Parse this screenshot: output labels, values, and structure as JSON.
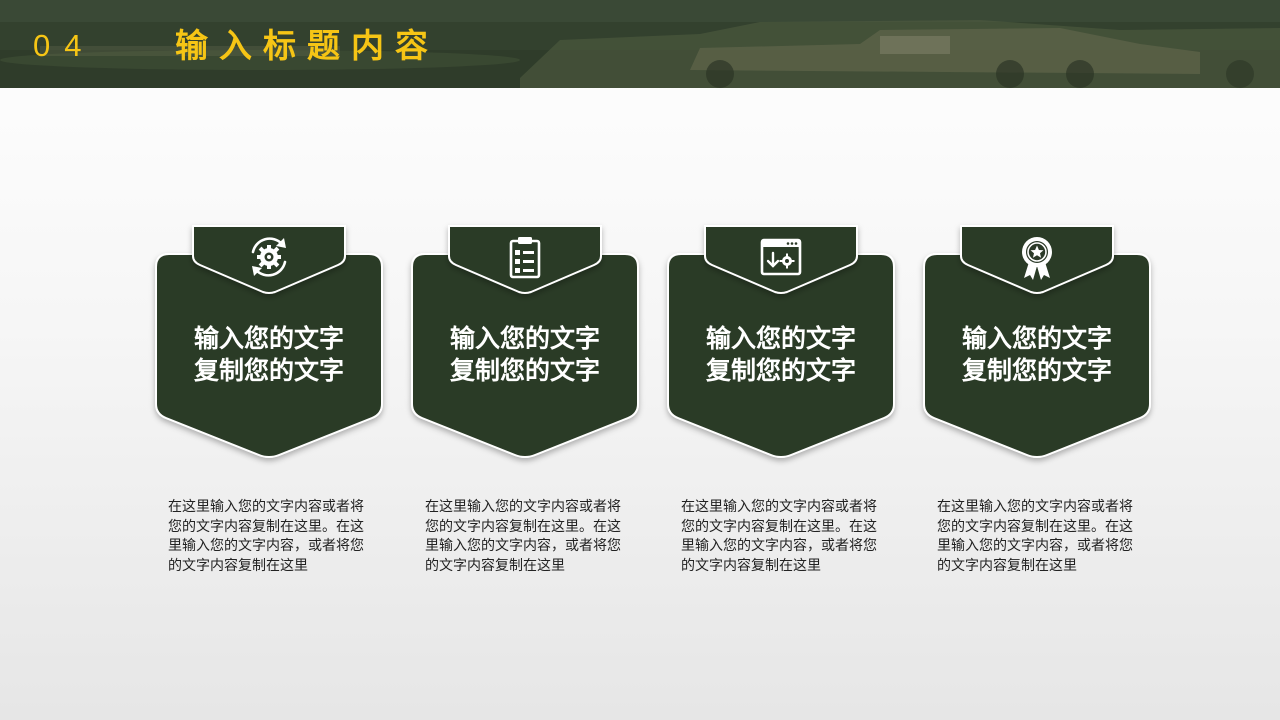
{
  "header": {
    "number": "04",
    "title": "输入标题内容"
  },
  "colors": {
    "card_fill": "#2c3a28",
    "accent_yellow": "#f6c515",
    "header_bg": "#3a4a34"
  },
  "cards": [
    {
      "icon": "gear-cycle-icon",
      "title_line1": "输入您的文字",
      "title_line2": "复制您的文字",
      "description": "在这里输入您的文字内容或者将您的文字内容复制在这里。在这里输入您的文字内容，或者将您的文字内容复制在这里"
    },
    {
      "icon": "clipboard-checklist-icon",
      "title_line1": "输入您的文字",
      "title_line2": "复制您的文字",
      "description": "在这里输入您的文字内容或者将您的文字内容复制在这里。在这里输入您的文字内容，或者将您的文字内容复制在这里"
    },
    {
      "icon": "browser-settings-icon",
      "title_line1": "输入您的文字",
      "title_line2": "复制您的文字",
      "description": "在这里输入您的文字内容或者将您的文字内容复制在这里。在这里输入您的文字内容，或者将您的文字内容复制在这里"
    },
    {
      "icon": "award-badge-icon",
      "title_line1": "输入您的文字",
      "title_line2": "复制您的文字",
      "description": "在这里输入您的文字内容或者将您的文字内容复制在这里。在这里输入您的文字内容，或者将您的文字内容复制在这里"
    }
  ]
}
